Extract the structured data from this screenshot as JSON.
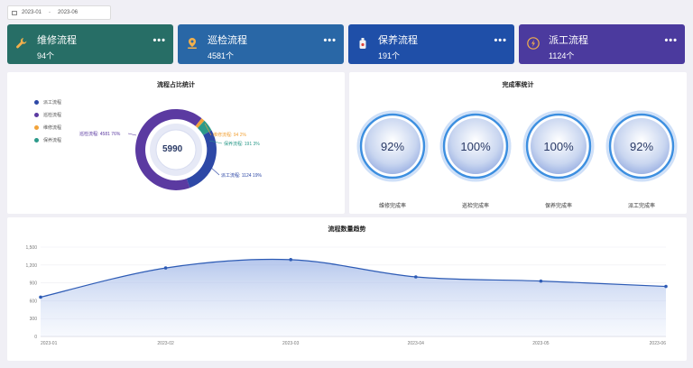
{
  "date_range": {
    "start": "2023-01",
    "separator": "-",
    "end": "2023-06"
  },
  "cards": [
    {
      "title": "维修流程",
      "count": "94个",
      "icon": "wrench-icon",
      "color": "#276e66"
    },
    {
      "title": "巡检流程",
      "count": "4581个",
      "icon": "map-pin-icon",
      "color": "#2967a6"
    },
    {
      "title": "保养流程",
      "count": "191个",
      "icon": "bottle-icon",
      "color": "#1f4fa8"
    },
    {
      "title": "派工流程",
      "count": "1124个",
      "icon": "lightning-icon",
      "color": "#4b3a9e"
    }
  ],
  "pie_panel": {
    "title": "流程占比统计",
    "center_total": "5990",
    "legend": [
      {
        "label": "派工流程",
        "color": "#2d48a6"
      },
      {
        "label": "巡检流程",
        "color": "#5b3aa1"
      },
      {
        "label": "维修流程",
        "color": "#f2a33a"
      },
      {
        "label": "保养流程",
        "color": "#2c9a8a"
      }
    ],
    "slice_labels": {
      "xunjian": "巡检流程: 4581  76%",
      "weixiu": "维修流程: 94  2%",
      "baoyang": "保养流程: 191  3%",
      "paigong": "派工流程: 1124  19%"
    }
  },
  "gauge_panel": {
    "title": "完成率统计",
    "gauges": [
      {
        "value": "92%",
        "label": "维修完成率"
      },
      {
        "value": "100%",
        "label": "巡检完成率"
      },
      {
        "value": "100%",
        "label": "保养完成率"
      },
      {
        "value": "92%",
        "label": "派工完成率"
      }
    ]
  },
  "chart_data": {
    "type": "area",
    "title": "流程数量趋势",
    "x": [
      "2023-01",
      "2023-02",
      "2023-03",
      "2023-04",
      "2023-05",
      "2023-06"
    ],
    "series": [
      {
        "values": [
          660,
          1150,
          1290,
          1000,
          930,
          840
        ]
      }
    ],
    "ylim": [
      0,
      1500
    ],
    "yticks": [
      "0",
      "300",
      "600",
      "900",
      "1,200",
      "1,500"
    ],
    "color": "#2d5bb5"
  }
}
